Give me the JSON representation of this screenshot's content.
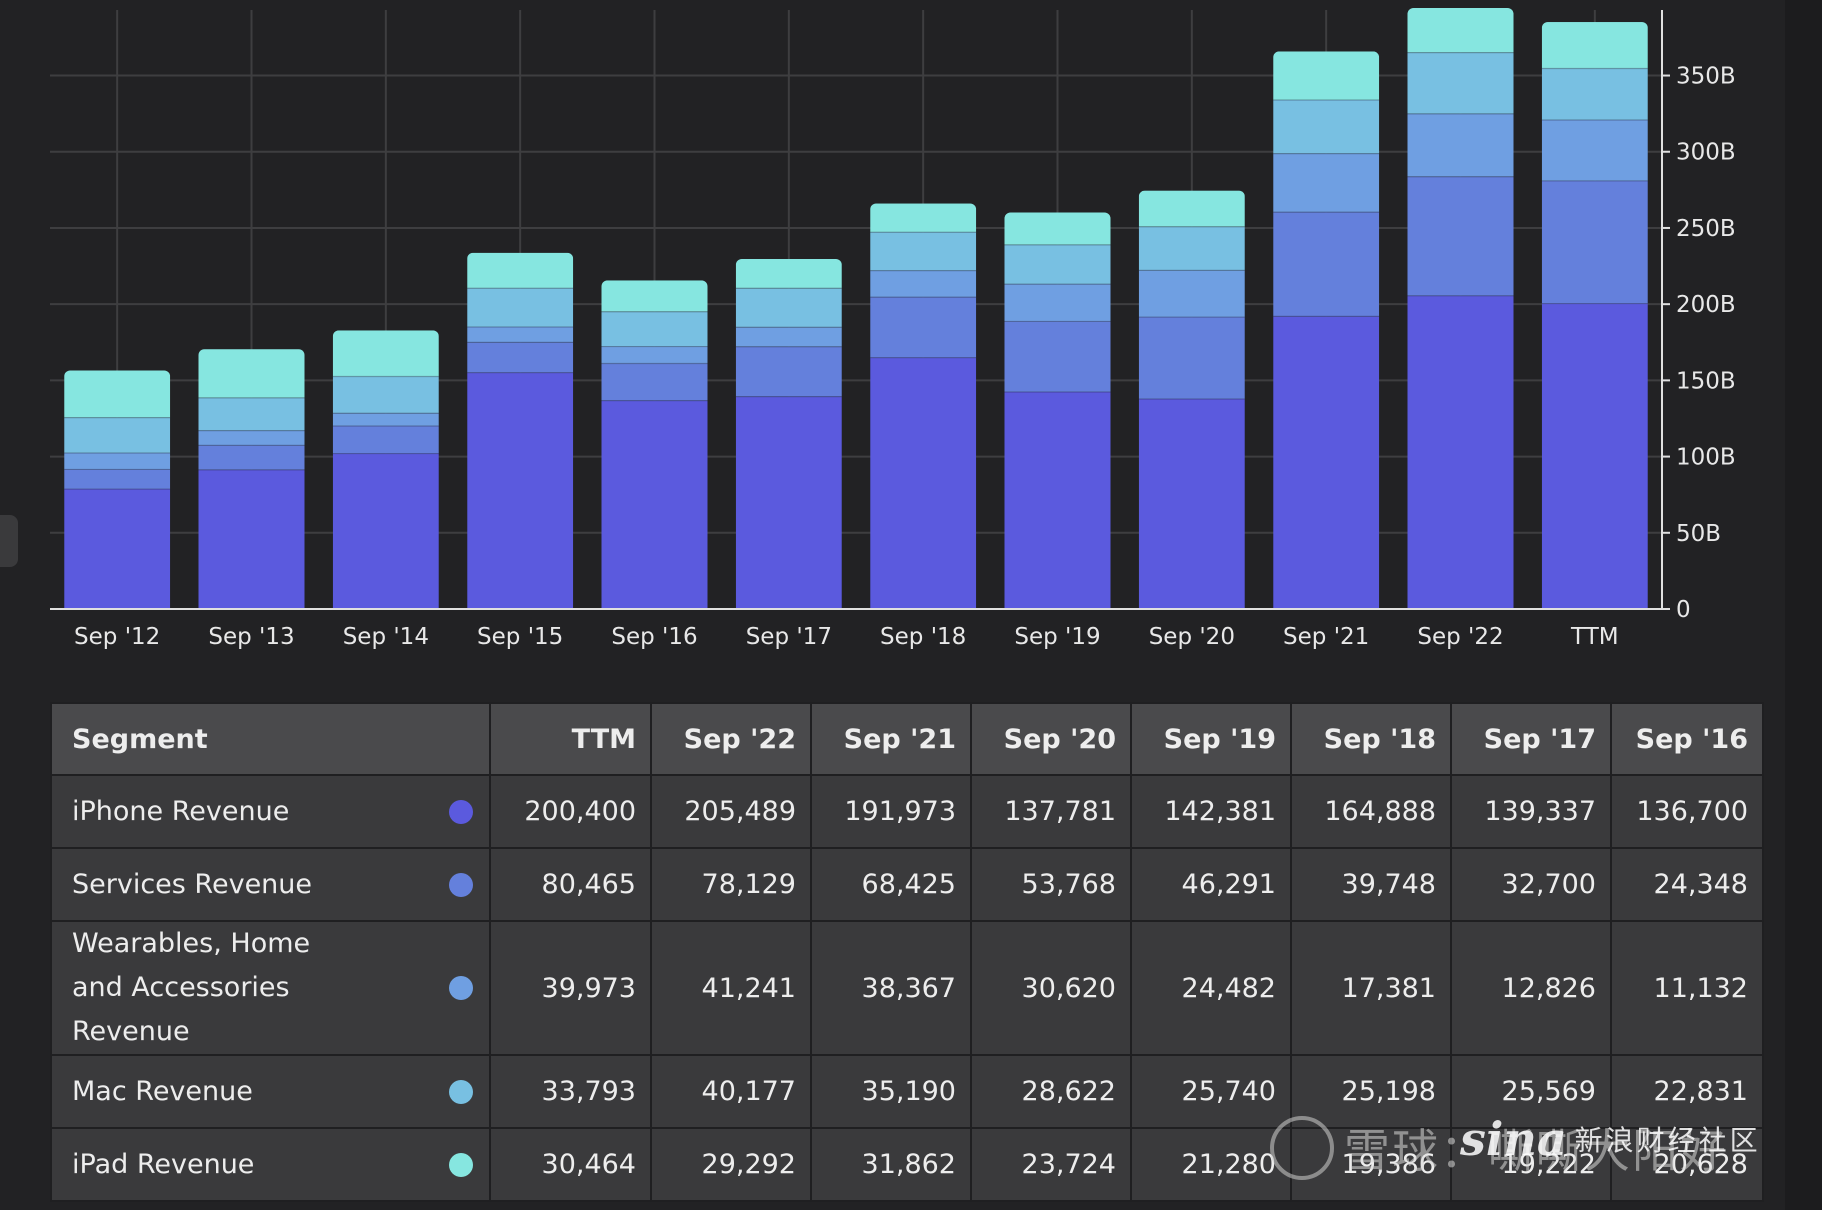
{
  "chart_data": {
    "type": "bar",
    "stacked": true,
    "categories": [
      "Sep '12",
      "Sep '13",
      "Sep '14",
      "Sep '15",
      "Sep '16",
      "Sep '17",
      "Sep '18",
      "Sep '19",
      "Sep '20",
      "Sep '21",
      "Sep '22",
      "TTM"
    ],
    "series": [
      {
        "name": "iPhone Revenue",
        "color": "#5b5ade",
        "values": [
          78692,
          91279,
          101991,
          155041,
          136700,
          139337,
          164888,
          142381,
          137781,
          191973,
          205489,
          200400
        ]
      },
      {
        "name": "Services Revenue",
        "color": "#6480dc",
        "values": [
          12890,
          16051,
          18063,
          19909,
          24348,
          32700,
          39748,
          46291,
          53768,
          68425,
          78129,
          80465
        ]
      },
      {
        "name": "Wearables, Home and Accessories Revenue",
        "color": "#6f9fe2",
        "values": [
          10760,
          9700,
          8400,
          10067,
          11132,
          12826,
          17381,
          24482,
          30620,
          38367,
          41241,
          39973
        ]
      },
      {
        "name": "Mac Revenue",
        "color": "#78c0e2",
        "values": [
          23221,
          21483,
          24079,
          25471,
          22831,
          25569,
          25198,
          25740,
          28622,
          35190,
          40177,
          33793
        ]
      },
      {
        "name": "iPad Revenue",
        "color": "#86e6e0",
        "values": [
          30945,
          31980,
          30283,
          23227,
          20628,
          19222,
          18805,
          21280,
          23724,
          31862,
          29292,
          30464
        ]
      }
    ],
    "y_tick_labels": [
      "0",
      "50B",
      "100B",
      "150B",
      "200B",
      "250B",
      "300B",
      "350B"
    ],
    "y_ticks": [
      0,
      50000,
      100000,
      150000,
      200000,
      250000,
      300000,
      350000
    ],
    "ylim": [
      0,
      393000
    ],
    "y_axis_side": "right",
    "grid": true,
    "legend": "none"
  },
  "table": {
    "columns": [
      "Segment",
      "TTM",
      "Sep '22",
      "Sep '21",
      "Sep '20",
      "Sep '19",
      "Sep '18",
      "Sep '17",
      "Sep '16"
    ],
    "rows": [
      {
        "segment": "iPhone Revenue",
        "dot_color": "#5b5ade",
        "values": [
          "200,400",
          "205,489",
          "191,973",
          "137,781",
          "142,381",
          "164,888",
          "139,337",
          "136,700"
        ]
      },
      {
        "segment": "Services Revenue",
        "dot_color": "#6480dc",
        "values": [
          "80,465",
          "78,129",
          "68,425",
          "53,768",
          "46,291",
          "39,748",
          "32,700",
          "24,348"
        ]
      },
      {
        "segment": "Wearables, Home and Accessories Revenue",
        "dot_color": "#6f9fe2",
        "values": [
          "39,973",
          "41,241",
          "38,367",
          "30,620",
          "24,482",
          "17,381",
          "12,826",
          "11,132"
        ]
      },
      {
        "segment": "Mac Revenue",
        "dot_color": "#78c0e2",
        "values": [
          "33,793",
          "40,177",
          "35,190",
          "28,622",
          "25,740",
          "25,198",
          "25,569",
          "22,831"
        ]
      },
      {
        "segment": "iPad Revenue",
        "dot_color": "#86e6e0",
        "values": [
          "30,464",
          "29,292",
          "31,862",
          "23,724",
          "21,280",
          "19,386",
          "19,222",
          "20,628"
        ]
      }
    ]
  },
  "watermark": {
    "text": "雪球：嘶嘶大阳好",
    "logo": "sina",
    "sub": "新浪财经社区"
  }
}
